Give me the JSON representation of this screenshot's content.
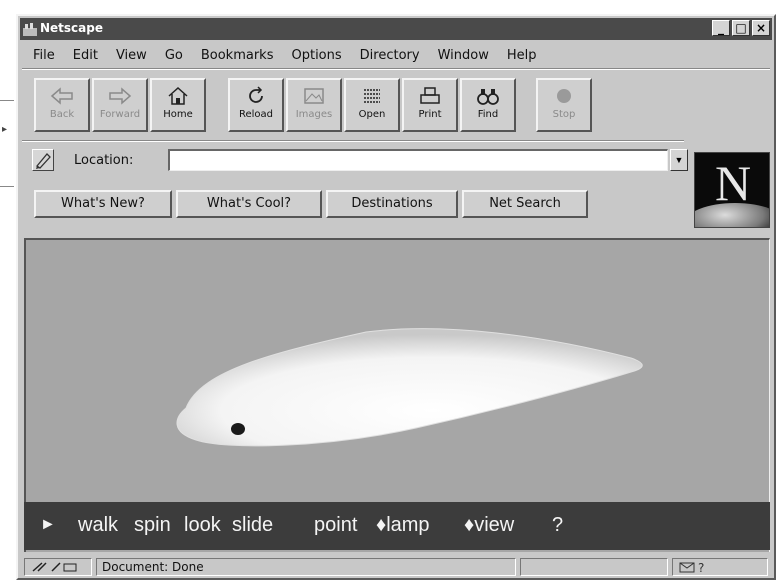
{
  "window": {
    "title": "Netscape"
  },
  "menu": [
    "File",
    "Edit",
    "View",
    "Go",
    "Bookmarks",
    "Options",
    "Directory",
    "Window",
    "Help"
  ],
  "toolbar": [
    {
      "label": "Back",
      "icon": "back-arrow-icon",
      "enabled": false
    },
    {
      "label": "Forward",
      "icon": "forward-arrow-icon",
      "enabled": false
    },
    {
      "label": "Home",
      "icon": "home-icon",
      "enabled": true
    },
    {
      "label": "Reload",
      "icon": "reload-icon",
      "enabled": true
    },
    {
      "label": "Images",
      "icon": "images-icon",
      "enabled": false
    },
    {
      "label": "Open",
      "icon": "open-icon",
      "enabled": true
    },
    {
      "label": "Print",
      "icon": "print-icon",
      "enabled": true
    },
    {
      "label": "Find",
      "icon": "find-binoculars-icon",
      "enabled": true
    },
    {
      "label": "Stop",
      "icon": "stop-icon",
      "enabled": false
    }
  ],
  "location": {
    "label": "Location:",
    "value": ""
  },
  "directory_buttons": [
    "What's New?",
    "What's Cool?",
    "Destinations",
    "Net Search"
  ],
  "logo": {
    "letter": "N"
  },
  "vrml_controls": [
    "►",
    "walk",
    "spin",
    "look",
    "slide",
    "point",
    "♦lamp",
    "♦view",
    "?"
  ],
  "status": {
    "text": "Document: Done"
  }
}
